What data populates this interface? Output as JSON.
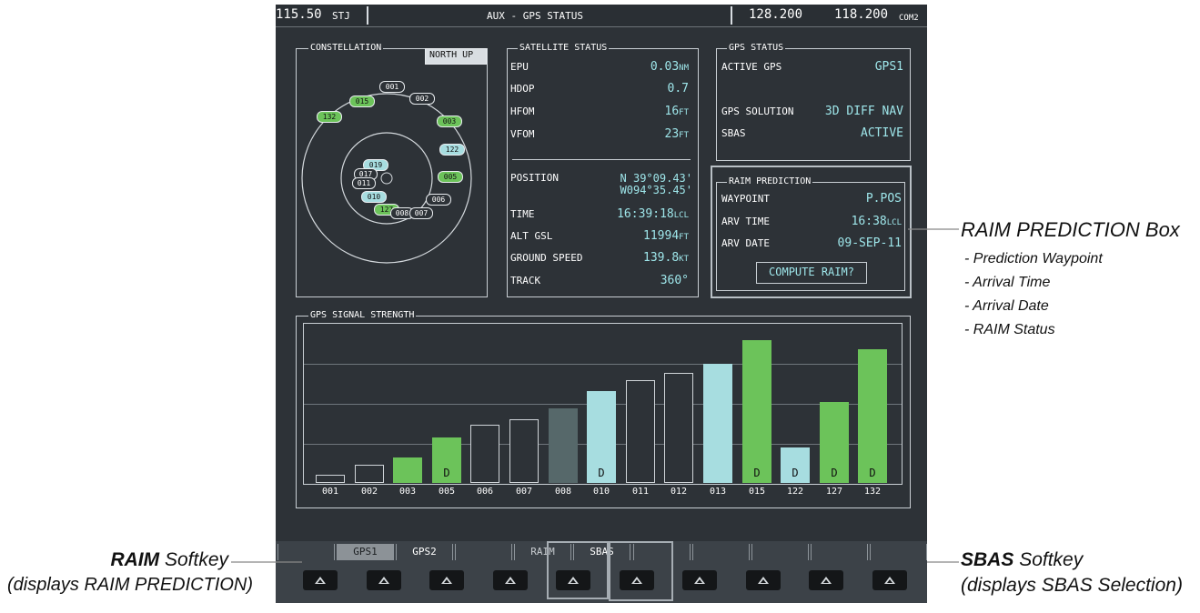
{
  "header": {
    "com1": "115.50",
    "com1_id": "STJ",
    "page_title": "AUX - GPS STATUS",
    "com_active": "128.200",
    "com_standby": "118.200",
    "com_label": "COM2"
  },
  "constellation": {
    "title": "CONSTELLATION",
    "orientation_button": "NORTH UP",
    "satellites": [
      "001",
      "002",
      "015",
      "132",
      "003",
      "122",
      "019",
      "017",
      "011",
      "005",
      "010",
      "006",
      "127",
      "008",
      "007"
    ]
  },
  "satellite_status": {
    "title": "SATELLITE STATUS",
    "rows": [
      {
        "label": "EPU",
        "value": "0.03",
        "unit": "NM"
      },
      {
        "label": "HDOP",
        "value": "0.7",
        "unit": ""
      },
      {
        "label": "HFOM",
        "value": "16",
        "unit": "FT"
      },
      {
        "label": "VFOM",
        "value": "23",
        "unit": "FT"
      }
    ],
    "position_label": "POSITION",
    "position_lat": "N 39°09.43'",
    "position_lon": "W094°35.45'",
    "rows2": [
      {
        "label": "TIME",
        "value": "16:39:18",
        "unit": "LCL"
      },
      {
        "label": "ALT GSL",
        "value": "11994",
        "unit": "FT"
      },
      {
        "label": "GROUND SPEED",
        "value": "139.8",
        "unit": "KT"
      },
      {
        "label": "TRACK",
        "value": "360°",
        "unit": ""
      }
    ]
  },
  "gps_status": {
    "title": "GPS STATUS",
    "active_gps_label": "ACTIVE GPS",
    "active_gps_value": "GPS1",
    "solution_label": "GPS SOLUTION",
    "solution_value": "3D DIFF NAV",
    "sbas_label": "SBAS",
    "sbas_value": "ACTIVE"
  },
  "raim": {
    "title": "RAIM PREDICTION",
    "waypoint_label": "WAYPOINT",
    "waypoint_value": "P.POS",
    "arv_time_label": "ARV TIME",
    "arv_time_value": "16:38",
    "arv_time_unit": "LCL",
    "arv_date_label": "ARV DATE",
    "arv_date_value": "09-SEP-11",
    "compute_button": "COMPUTE RAIM?"
  },
  "signal_strength": {
    "title": "GPS SIGNAL STRENGTH"
  },
  "chart_data": {
    "type": "bar",
    "title": "GPS SIGNAL STRENGTH",
    "categories": [
      "001",
      "002",
      "003",
      "005",
      "006",
      "007",
      "008",
      "010",
      "011",
      "012",
      "013",
      "015",
      "122",
      "127",
      "132"
    ],
    "values": [
      0.07,
      0.15,
      0.21,
      0.38,
      0.48,
      0.53,
      0.62,
      0.76,
      0.85,
      0.91,
      0.99,
      1.18,
      0.29,
      0.67,
      1.11
    ],
    "colors": [
      "#2d3237",
      "#2d3237",
      "#6cc35a",
      "#6cc35a",
      "#2d3237",
      "#2d3237",
      "#56686a",
      "#a7dde0",
      "#2d3237",
      "#2d3237",
      "#a7dde0",
      "#6cc35a",
      "#a7dde0",
      "#6cc35a",
      "#6cc35a"
    ],
    "d_flags": [
      false,
      false,
      false,
      true,
      false,
      false,
      false,
      true,
      false,
      false,
      false,
      true,
      true,
      true,
      true
    ],
    "d_label": "D",
    "ylim": [
      0,
      1.25
    ]
  },
  "softkeys": {
    "labels": [
      "",
      "GPS1",
      "GPS2",
      "",
      "RAIM",
      "SBAS",
      "",
      "",
      "",
      "",
      ""
    ],
    "active_index": 1
  },
  "callouts": {
    "raim_box_title": "RAIM PREDICTION Box",
    "raim_box_items": [
      "- Prediction Waypoint",
      "- Arrival Time",
      "- Arrival Date",
      "- RAIM Status"
    ],
    "raim_softkey_bold": "RAIM",
    "raim_softkey_rest": " Softkey",
    "raim_softkey_sub": "(displays RAIM PREDICTION)",
    "sbas_softkey_bold": "SBAS",
    "sbas_softkey_rest": " Softkey",
    "sbas_softkey_sub": "(displays SBAS Selection)"
  },
  "colors": {
    "screen_bg": "#2d3237",
    "cyan_text": "#9ee6ea",
    "green_bar": "#6cc35a",
    "cyan_bar": "#a7dde0"
  }
}
